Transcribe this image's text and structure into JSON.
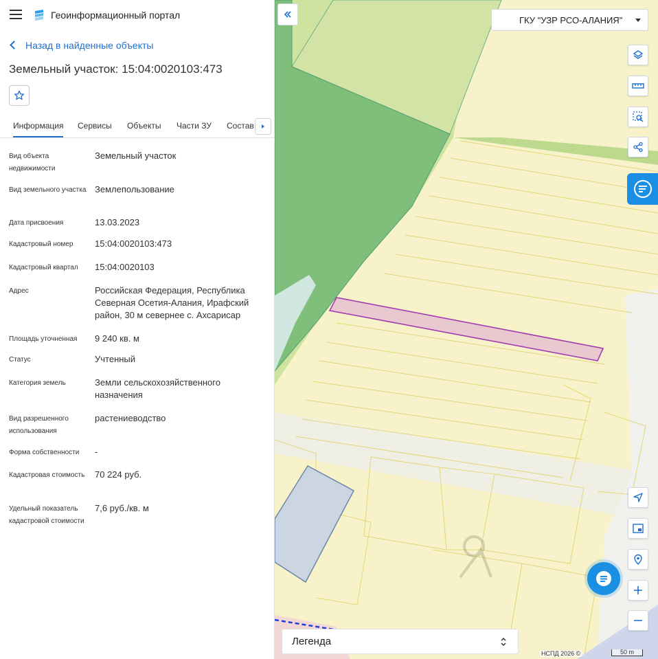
{
  "app": {
    "title": "Геоинформационный портал"
  },
  "nav": {
    "back_label": "Назад в найденные объекты"
  },
  "object": {
    "title": "Земельный участок: 15:04:0020103:473"
  },
  "tabs": [
    {
      "label": "Информация"
    },
    {
      "label": "Сервисы"
    },
    {
      "label": "Объекты"
    },
    {
      "label": "Части ЗУ"
    },
    {
      "label": "Состав"
    }
  ],
  "properties": [
    {
      "label": "Вид объекта недвижимости",
      "value": "Земельный участок"
    },
    {
      "label": "Вид земельного участка",
      "value": "Землепользование"
    },
    {
      "label": "Дата присвоения",
      "value": "13.03.2023"
    },
    {
      "label": "Кадастровый номер",
      "value": "15:04:0020103:473"
    },
    {
      "label": "Кадастровый квартал",
      "value": "15:04:0020103"
    },
    {
      "label": "Адрес",
      "value": "Российская Федерация, Республика Северная Осетия-Алания, Ирафский район, 30 м севернее с. Ахсарисар"
    },
    {
      "label": "Площадь уточненная",
      "value": "9 240 кв. м"
    },
    {
      "label": "Статус",
      "value": "Учтенный"
    },
    {
      "label": "Категория земель",
      "value": "Земли сельскохозяйственного назначения"
    },
    {
      "label": "Вид разрешенного использования",
      "value": "растениеводство"
    },
    {
      "label": "Форма собственности",
      "value": "-"
    },
    {
      "label": "Кадастровая стоимость",
      "value": "70 224 руб."
    },
    {
      "label": "Удельный показатель кадастровой стоимости",
      "value": "7,6 руб./кв. м"
    }
  ],
  "map": {
    "org_selector": "ГКУ \"УЗР РСО-АЛАНИЯ\"",
    "legend_label": "Легенда",
    "credit": "НСПД 2026 ©",
    "scale_label": "50 m"
  },
  "colors": {
    "accent": "#1f6fd0",
    "parcel_fill": "#f7f2c6",
    "parcel_line": "#e0d27a",
    "forest": "#7fbf7b",
    "selected_outline": "#a23bb0",
    "selected_fill": "#e9c9cf"
  }
}
